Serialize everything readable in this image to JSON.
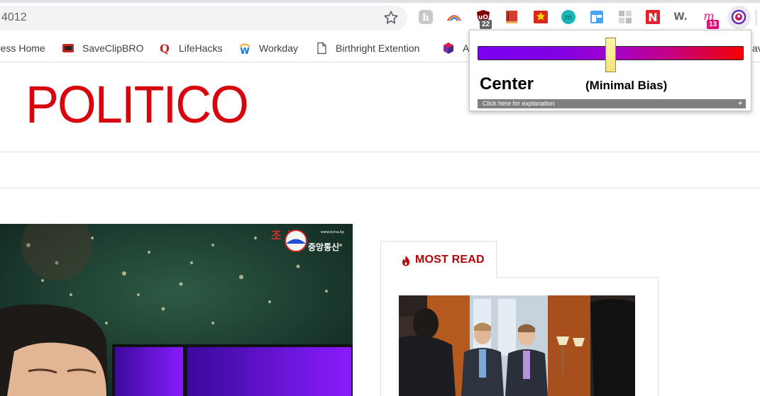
{
  "omnibox": {
    "url_fragment": "4012"
  },
  "bookmarks": [
    {
      "label": "ress Home",
      "icon": "partial-icon"
    },
    {
      "label": "SaveClipBRO",
      "icon": "saveclipbro-icon"
    },
    {
      "label": "LifeHacks",
      "icon": "quora-q-icon"
    },
    {
      "label": "Workday",
      "icon": "workday-icon"
    },
    {
      "label": "Birthright Extention",
      "icon": "page-icon"
    },
    {
      "label": "A",
      "icon": "cube-icon"
    }
  ],
  "extensions": {
    "badges": {
      "ublock": "22",
      "m": "13"
    }
  },
  "popup": {
    "bias_label": "Center",
    "bias_desc": "(Minimal Bias)",
    "explain_text": "Click here for explanation",
    "expand_symbol": "+",
    "bias_position": 0.5,
    "colors": {
      "left": "#7b00f2",
      "right": "#f50000"
    }
  },
  "site": {
    "logo": "POLITICO",
    "most_read": "MOST READ",
    "brand_color": "#d8050d",
    "accent_color": "#b4050a"
  },
  "hero": {
    "watermark_top": "조 선",
    "watermark_bottom": "중앙통신",
    "watermark_small": "www.kcna.kp"
  }
}
